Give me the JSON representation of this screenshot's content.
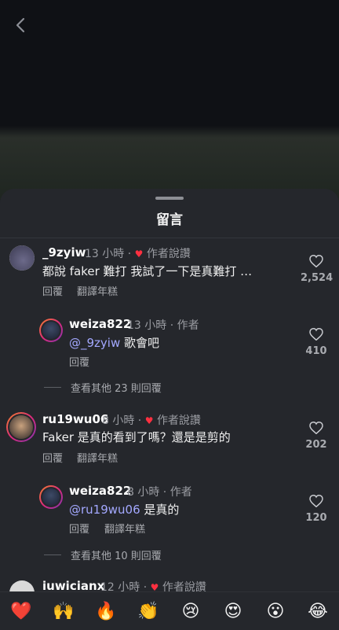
{
  "sheet": {
    "title": "留言"
  },
  "comments": [
    {
      "username": "_9zyiw",
      "time": "13 小時",
      "badge": "作者說讚",
      "text": "都說 faker 難打 我試了一下是真難打 …",
      "reply_label": "回覆",
      "translate_label": "翻譯年糕",
      "likes": "2,524"
    },
    {
      "username": "weiza822",
      "time": "13 小時",
      "role": "作者",
      "mention": "@_9zyiw",
      "text": " 歌會吧",
      "reply_label": "回覆",
      "likes": "410"
    },
    {
      "username": "ru19wu06",
      "time": "8 小時",
      "badge": "作者說讚",
      "text": "Faker 是真的看到了嗎？還是是剪的",
      "reply_label": "回覆",
      "translate_label": "翻譯年糕",
      "likes": "202"
    },
    {
      "username": "weiza822",
      "time": "8 小時",
      "role": "作者",
      "mention": "@ru19wu06",
      "text": " 是真的",
      "reply_label": "回覆",
      "translate_label": "翻譯年糕",
      "likes": "120"
    },
    {
      "username": "iuwicianx",
      "time": "12 小時",
      "badge": "作者說讚"
    }
  ],
  "view_more": [
    {
      "label": "查看其他 23 則回覆"
    },
    {
      "label": "查看其他 10 則回覆"
    }
  ],
  "emoji_bar": [
    "❤️",
    "🙌",
    "🔥",
    "👏",
    "😢",
    "😍",
    "😮",
    "😂"
  ],
  "colors": {
    "accent_heart": "#ff3040",
    "mention": "#a3a8ff",
    "sheet_bg": "#25272c"
  }
}
